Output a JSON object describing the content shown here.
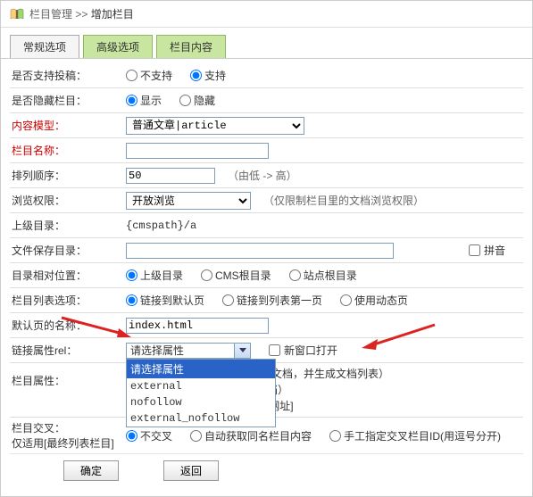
{
  "breadcrumb": {
    "mgmt": "栏目管理",
    "sep": ">>",
    "cur": "增加栏目"
  },
  "tabs": {
    "t1": "常规选项",
    "t2": "高级选项",
    "t3": "栏目内容"
  },
  "labels": {
    "submit": "是否支持投稿：",
    "hidden": "是否隐藏栏目：",
    "model": "内容模型：",
    "name": "栏目名称：",
    "order": "排列顺序：",
    "browse": "浏览权限：",
    "parent": "上级目录：",
    "savedir": "文件保存目录：",
    "relpos": "目录相对位置：",
    "listopt": "栏目列表选项：",
    "defname": "默认页的名称：",
    "rel": "链接属性rel：",
    "colattr": "栏目属性：",
    "cross": "栏目交叉：",
    "cross_hint": "仅适用[最终列表栏目]"
  },
  "radio": {
    "no_support": "不支持",
    "support": "支持",
    "show": "显示",
    "hide": "隐藏",
    "relpos_parent": "上级目录",
    "relpos_cms": "CMS根目录",
    "relpos_site": "站点根目录",
    "listopt_def": "链接到默认页",
    "listopt_first": "链接到列表第一页",
    "listopt_dyn": "使用动态页",
    "cross_no": "不交叉",
    "cross_auto": "自动获取同名栏目内容",
    "cross_manual": "手工指定交叉栏目ID(用逗号分开)"
  },
  "values": {
    "model": "普通文章|article",
    "order": "50",
    "order_hint": "（由低 -> 高）",
    "browse": "开放浏览",
    "browse_hint": "（仅限制栏目里的文档浏览权限）",
    "parent": "{cmspath}/a",
    "defname": "index.html"
  },
  "rel": {
    "ph": "请选择属性",
    "o1": "请选择属性",
    "o2": "external",
    "o3": "nofollow",
    "o4": "external_nofollow",
    "newwin": "新窗口打开"
  },
  "colattr": {
    "l1_b": "E本栏目发布文档，并生成文档列表）",
    "l2": "不允许发布文档）",
    "l3": "目目录'处填写网址]"
  },
  "misc": {
    "pinyin": "拼音"
  },
  "buttons": {
    "ok": "确定",
    "back": "返回"
  }
}
